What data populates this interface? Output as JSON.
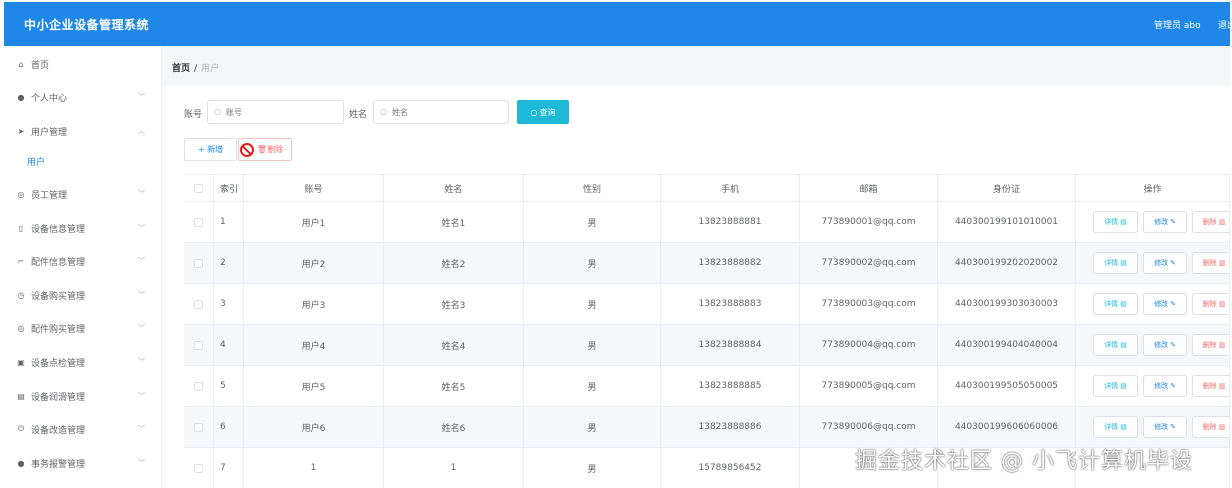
{
  "header": {
    "title": "中小企业设备管理系统",
    "user": "管理员 abo",
    "logout": "退出"
  },
  "sidebar": {
    "items": [
      {
        "label": "首页",
        "icon": "home-icon"
      },
      {
        "label": "个人中心",
        "icon": "user-icon"
      },
      {
        "label": "用户管理",
        "icon": "send-icon",
        "expanded": true
      },
      {
        "label": "员工管理",
        "icon": "globe-icon"
      },
      {
        "label": "设备信息管理",
        "icon": "phone-icon"
      },
      {
        "label": "配件信息管理",
        "icon": "crop-icon"
      },
      {
        "label": "设备购买管理",
        "icon": "clock-icon"
      },
      {
        "label": "配件购买管理",
        "icon": "globe-icon"
      },
      {
        "label": "设备点检管理",
        "icon": "clipboard-icon"
      },
      {
        "label": "设备润滑管理",
        "icon": "document-icon"
      },
      {
        "label": "设备改造管理",
        "icon": "power-icon"
      },
      {
        "label": "事务报警管理",
        "icon": "user-icon"
      }
    ],
    "submenu_active": "用户"
  },
  "breadcrumb": {
    "home": "首页",
    "separator": "/",
    "current": "用户"
  },
  "search": {
    "account_label": "账号",
    "account_placeholder": "账号",
    "name_label": "姓名",
    "name_placeholder": "姓名",
    "query_button": "查询"
  },
  "actions": {
    "add_button": "+ 新增",
    "delete_button": "删除"
  },
  "table": {
    "headers": [
      "索引",
      "账号",
      "姓名",
      "性别",
      "手机",
      "邮箱",
      "身份证",
      "操作"
    ],
    "rows": [
      {
        "index": "1",
        "account": "用户1",
        "name": "姓名1",
        "gender": "男",
        "phone": "13823888881",
        "email": "773890001@qq.com",
        "idcard": "440300199101010001"
      },
      {
        "index": "2",
        "account": "用户2",
        "name": "姓名2",
        "gender": "男",
        "phone": "13823888882",
        "email": "773890002@qq.com",
        "idcard": "440300199202020002"
      },
      {
        "index": "3",
        "account": "用户3",
        "name": "姓名3",
        "gender": "男",
        "phone": "13823888883",
        "email": "773890003@qq.com",
        "idcard": "440300199303030003"
      },
      {
        "index": "4",
        "account": "用户4",
        "name": "姓名4",
        "gender": "男",
        "phone": "13823888884",
        "email": "773890004@qq.com",
        "idcard": "440300199404040004"
      },
      {
        "index": "5",
        "account": "用户5",
        "name": "姓名5",
        "gender": "男",
        "phone": "13823888885",
        "email": "773890005@qq.com",
        "idcard": "440300199505050005"
      },
      {
        "index": "6",
        "account": "用户6",
        "name": "姓名6",
        "gender": "男",
        "phone": "13823888886",
        "email": "773890006@qq.com",
        "idcard": "440300199606060006"
      },
      {
        "index": "7",
        "account": "1",
        "name": "1",
        "gender": "男",
        "phone": "15789856452",
        "email": "",
        "idcard": ""
      }
    ],
    "op_labels": {
      "detail": "详情",
      "edit": "修改",
      "remove": "删除"
    }
  },
  "watermark": "掘金技术社区 @ 小飞计算机毕设",
  "colors": {
    "header_bg": "#1e87e8",
    "query_button": "#1eb9d9",
    "active_submenu": "#1e87e8",
    "danger": "#f56c6c",
    "stripe": "#f5f7fa"
  }
}
